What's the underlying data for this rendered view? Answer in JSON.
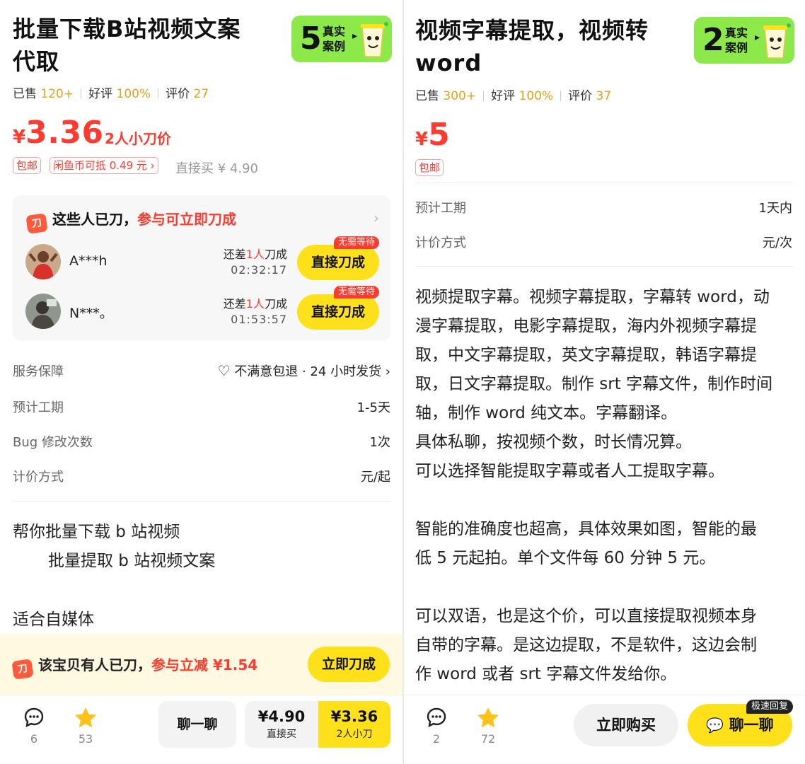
{
  "left": {
    "title_line1": "批量下载B站视频文案",
    "title_line2": "代取",
    "case_badge": {
      "count": "5",
      "label": "真实案例",
      "arrow": "▸"
    },
    "stats": {
      "sold_label": "已售",
      "sold": "120+",
      "good_label": "好评",
      "good": "100%",
      "review_label": "评价",
      "review": "27"
    },
    "price": {
      "currency": "¥",
      "value": "3.36",
      "note": "2人小刀价"
    },
    "tags": {
      "free_shipping": "包邮",
      "coin": "闲鱼币可抵 0.49 元 ›",
      "direct_buy": "直接买 ¥ 4.90"
    },
    "kanjia": {
      "icon": "刀",
      "title": "这些人已刀，",
      "title_red": "参与可立即刀成",
      "chevron": "›",
      "rows": [
        {
          "name": "A***h",
          "need_prefix": "还差",
          "need_num": "1人",
          "need_suffix": "刀成",
          "time": "02:32:17",
          "tag": "无需等待",
          "button": "直接刀成"
        },
        {
          "name": "N***。",
          "need_prefix": "还差",
          "need_num": "1人",
          "need_suffix": "刀成",
          "time": "01:53:57",
          "tag": "无需等待",
          "button": "直接刀成"
        }
      ]
    },
    "info": [
      {
        "label": "服务保障",
        "value": "不满意包退 · 24 小时发货 ›"
      },
      {
        "label": "预计工期",
        "value": "1-5天"
      },
      {
        "label": "Bug 修改次数",
        "value": "1次"
      },
      {
        "label": "计价方式",
        "value": "元/起"
      }
    ],
    "desc_line1": "帮你批量下载 b 站视频",
    "desc_line2": "批量提取 b 站视频文案",
    "desc_line3": "适合自媒体",
    "promo": {
      "icon": "刀",
      "text": "该宝贝有人已刀，",
      "text_red": "参与立减 ¥1.54",
      "button": "立即刀成"
    },
    "bottom": {
      "comment_count": "6",
      "star_count": "53",
      "chat": "聊一聊",
      "direct_price": "¥4.90",
      "direct_label": "直接买",
      "kj_price": "¥3.36",
      "kj_label": "2人小刀"
    }
  },
  "right": {
    "title_line1": "视频字幕提取，视频转",
    "title_line2": "word",
    "case_badge": {
      "count": "2",
      "label": "真实案例",
      "arrow": "▸"
    },
    "stats": {
      "sold_label": "已售",
      "sold": "300+",
      "good_label": "好评",
      "good": "100%",
      "review_label": "评价",
      "review": "37"
    },
    "price": {
      "currency": "¥",
      "value": "5"
    },
    "tags": {
      "free_shipping": "包邮"
    },
    "info": [
      {
        "label": "预计工期",
        "value": "1天内"
      },
      {
        "label": "计价方式",
        "value": "元/次"
      }
    ],
    "desc_lines": [
      "视频提取字幕。视频字幕提取，字幕转 word，动",
      "漫字幕提取，电影字幕提取，海内外视频字幕提",
      "取，中文字幕提取，英文字幕提取，韩语字幕提",
      "取，日文字幕提取。制作 srt 字幕文件，制作时间",
      "轴，制作 word 纯文本。字幕翻译。",
      "具体私聊，按视频个数，时长情况算。",
      "可以选择智能提取字幕或者人工提取字幕。",
      "",
      "智能的准确度也超高，具体效果如图，智能的最",
      "低 5 元起拍。单个文件每 60 分钟 5 元。",
      "",
      "可以双语，也是这个价，可以直接提取视频本身",
      "自带的字幕。是这边提取，不是软件，这边会制",
      "作 word 或者 srt 字幕文件发给你。"
    ],
    "bottom": {
      "comment_count": "2",
      "star_count": "72",
      "buy_now": "立即购买",
      "chat": "聊一聊",
      "fast_tag": "极速回复"
    }
  }
}
